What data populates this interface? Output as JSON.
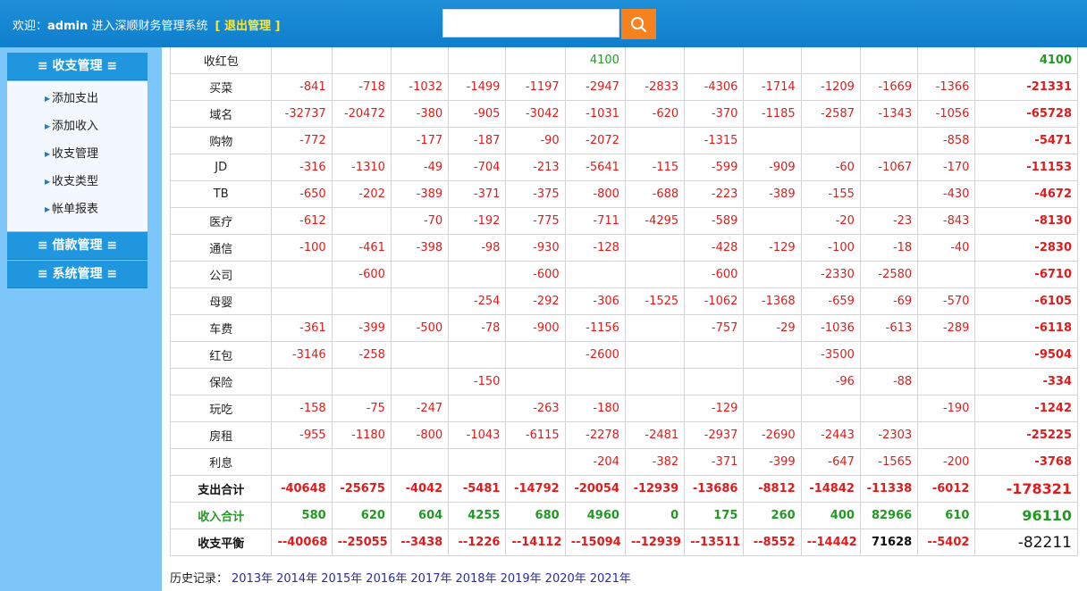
{
  "header": {
    "welcome_prefix": "欢迎：",
    "username": "admin",
    "welcome_suffix": " 进入深顺财务管理系统",
    "logout": "[ 退出管理 ]"
  },
  "search": {
    "value": "",
    "placeholder": "",
    "icon": "search-icon"
  },
  "sidebar": {
    "groups": [
      {
        "label": "≡ 收支管理 ≡"
      },
      {
        "label": "≡ 借款管理 ≡"
      },
      {
        "label": "≡ 系统管理 ≡"
      }
    ],
    "items": [
      {
        "label": "添加支出"
      },
      {
        "label": "添加收入"
      },
      {
        "label": "收支管理"
      },
      {
        "label": "收支类型"
      },
      {
        "label": "帐单报表"
      }
    ]
  },
  "report": {
    "rows": [
      {
        "category": "收红包",
        "kind": "income",
        "values": [
          "",
          "",
          "",
          "",
          "",
          "4100",
          "",
          "",
          "",
          "",
          "",
          ""
        ],
        "total": "4100"
      },
      {
        "category": "买菜",
        "values": [
          "-841",
          "-718",
          "-1032",
          "-1499",
          "-1197",
          "-2947",
          "-2833",
          "-4306",
          "-1714",
          "-1209",
          "-1669",
          "-1366"
        ],
        "total": "-21331"
      },
      {
        "category": "域名",
        "values": [
          "-32737",
          "-20472",
          "-380",
          "-905",
          "-3042",
          "-1031",
          "-620",
          "-370",
          "-1185",
          "-2587",
          "-1343",
          "-1056"
        ],
        "total": "-65728"
      },
      {
        "category": "购物",
        "values": [
          "-772",
          "",
          "-177",
          "-187",
          "-90",
          "-2072",
          "",
          "-1315",
          "",
          "",
          "",
          "-858"
        ],
        "total": "-5471"
      },
      {
        "category": "JD",
        "values": [
          "-316",
          "-1310",
          "-49",
          "-704",
          "-213",
          "-5641",
          "-115",
          "-599",
          "-909",
          "-60",
          "-1067",
          "-170"
        ],
        "total": "-11153"
      },
      {
        "category": "TB",
        "values": [
          "-650",
          "-202",
          "-389",
          "-371",
          "-375",
          "-800",
          "-688",
          "-223",
          "-389",
          "-155",
          "",
          "-430"
        ],
        "total": "-4672"
      },
      {
        "category": "医疗",
        "values": [
          "-612",
          "",
          "-70",
          "-192",
          "-775",
          "-711",
          "-4295",
          "-589",
          "",
          "-20",
          "-23",
          "-843"
        ],
        "total": "-8130"
      },
      {
        "category": "通信",
        "values": [
          "-100",
          "-461",
          "-398",
          "-98",
          "-930",
          "-128",
          "",
          "-428",
          "-129",
          "-100",
          "-18",
          "-40"
        ],
        "total": "-2830"
      },
      {
        "category": "公司",
        "values": [
          "",
          "-600",
          "",
          "",
          "-600",
          "",
          "",
          "-600",
          "",
          "-2330",
          "-2580",
          ""
        ],
        "total": "-6710"
      },
      {
        "category": "母婴",
        "values": [
          "",
          "",
          "",
          "-254",
          "-292",
          "-306",
          "-1525",
          "-1062",
          "-1368",
          "-659",
          "-69",
          "-570"
        ],
        "total": "-6105"
      },
      {
        "category": "车费",
        "values": [
          "-361",
          "-399",
          "-500",
          "-78",
          "-900",
          "-1156",
          "",
          "-757",
          "-29",
          "-1036",
          "-613",
          "-289"
        ],
        "total": "-6118"
      },
      {
        "category": "红包",
        "values": [
          "-3146",
          "-258",
          "",
          "",
          "",
          "-2600",
          "",
          "",
          "",
          "-3500",
          "",
          ""
        ],
        "total": "-9504"
      },
      {
        "category": "保险",
        "values": [
          "",
          "",
          "",
          "-150",
          "",
          "",
          "",
          "",
          "",
          "-96",
          "-88",
          ""
        ],
        "total": "-334"
      },
      {
        "category": "玩吃",
        "values": [
          "-158",
          "-75",
          "-247",
          "",
          "-263",
          "-180",
          "",
          "-129",
          "",
          "",
          "",
          "-190"
        ],
        "total": "-1242"
      },
      {
        "category": "房租",
        "values": [
          "-955",
          "-1180",
          "-800",
          "-1043",
          "-6115",
          "-2278",
          "-2481",
          "-2937",
          "-2690",
          "-2443",
          "-2303",
          ""
        ],
        "total": "-25225"
      },
      {
        "category": "利息",
        "values": [
          "",
          "",
          "",
          "",
          "",
          "-204",
          "-382",
          "-371",
          "-399",
          "-647",
          "-1565",
          "-200"
        ],
        "total": "-3768"
      }
    ],
    "expense_total": {
      "label": "支出合计",
      "values": [
        "-40648",
        "-25675",
        "-4042",
        "-5481",
        "-14792",
        "-20054",
        "-12939",
        "-13686",
        "-8812",
        "-14842",
        "-11338",
        "-6012"
      ],
      "total": "-178321"
    },
    "income_total": {
      "label": "收入合计",
      "values": [
        "580",
        "620",
        "604",
        "4255",
        "680",
        "4960",
        "0",
        "175",
        "260",
        "400",
        "82966",
        "610"
      ],
      "total": "96110"
    },
    "balance": {
      "label": "收支平衡",
      "values": [
        "--40068",
        "--25055",
        "--3438",
        "--1226",
        "--14112",
        "--15094",
        "--12939",
        "--13511",
        "--8552",
        "--14442",
        "71628",
        "--5402"
      ],
      "total": "-82211"
    }
  },
  "history": {
    "label": "历史记录：",
    "years": [
      "2013年",
      "2014年",
      "2015年",
      "2016年",
      "2017年",
      "2018年",
      "2019年",
      "2020年",
      "2021年"
    ]
  },
  "colors": {
    "header_bg": "#1188d6",
    "sidebar_bg": "#7cc6fa",
    "menu_header_bg": "#2096df",
    "search_btn": "#f5811f",
    "expense": "#e01b1b",
    "income": "#229922",
    "logout": "#ffe733"
  }
}
